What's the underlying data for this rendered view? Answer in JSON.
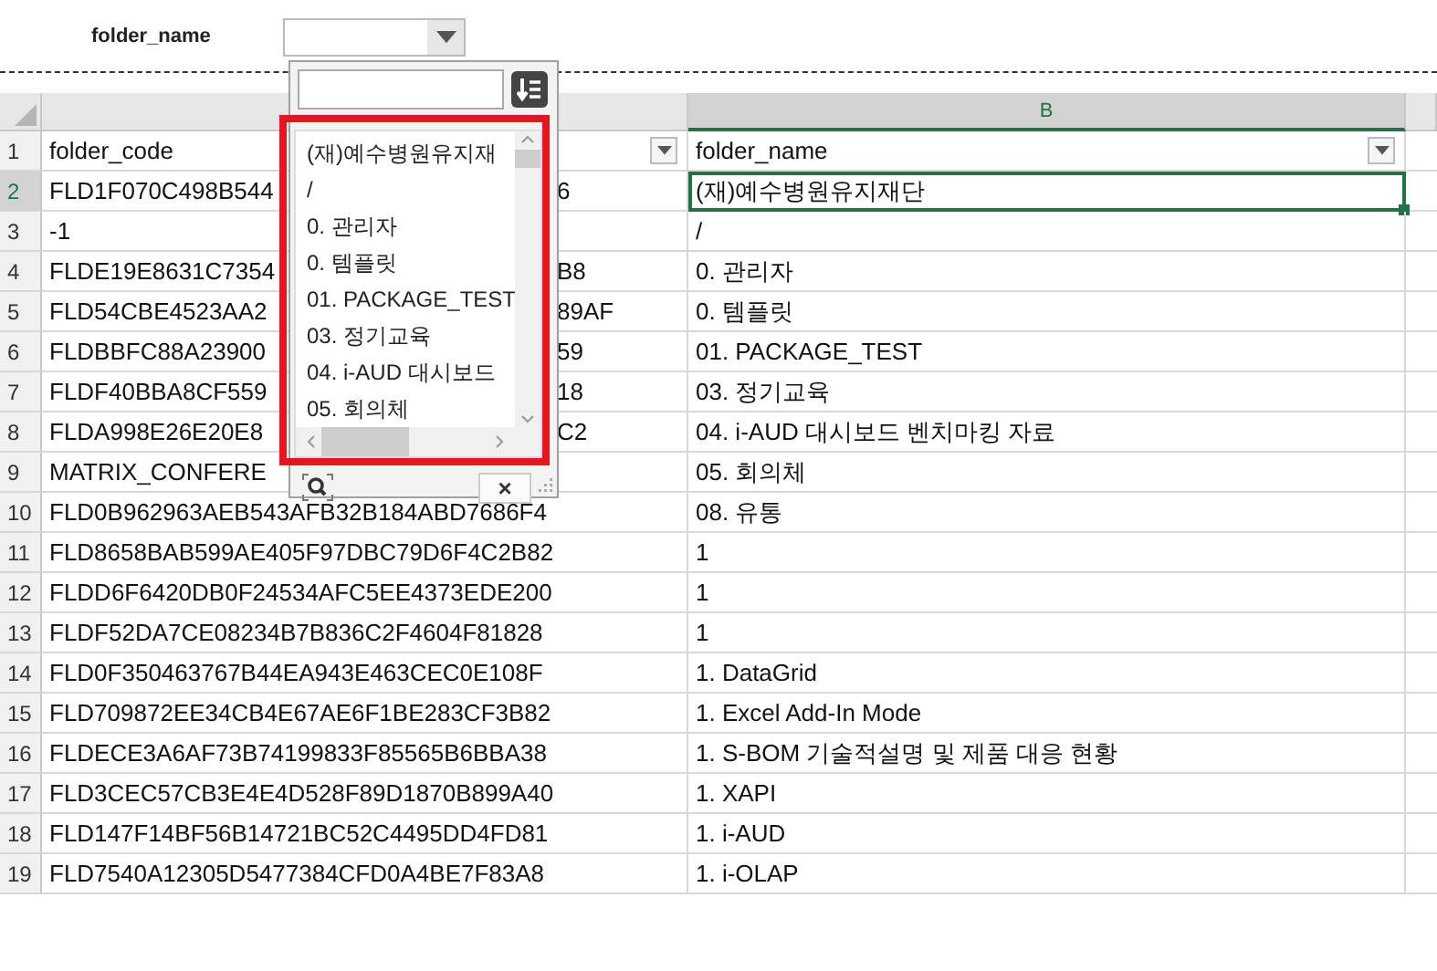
{
  "filter_bar": {
    "label": "folder_name"
  },
  "popup": {
    "items": [
      {
        "text": "(재)예수병원유지재"
      },
      {
        "text": "/"
      },
      {
        "text": "0. 관리자"
      },
      {
        "text": "0. 템플릿"
      },
      {
        "text": "01. PACKAGE_TEST"
      },
      {
        "text": "03. 정기교육"
      },
      {
        "text": "04. i-AUD 대시보드"
      },
      {
        "text": "05. 회의체"
      }
    ],
    "close_label": "×"
  },
  "sheet": {
    "column_headers": [
      {
        "label": "B",
        "selected": true
      }
    ],
    "rows": [
      {
        "number": "1",
        "selected": false,
        "cells": [
          {
            "text": "folder_code",
            "filter": true,
            "selected": false
          },
          {
            "text": "folder_name",
            "filter": true,
            "selected": false
          }
        ]
      },
      {
        "number": "2",
        "selected": true,
        "cells": [
          {
            "text": "FLD1F070C498B544",
            "tail": "6",
            "selected": false
          },
          {
            "text": "(재)예수병원유지재단",
            "selected": true
          }
        ]
      },
      {
        "number": "3",
        "selected": false,
        "cells": [
          {
            "text": "-1",
            "selected": false
          },
          {
            "text": "/",
            "selected": false
          }
        ]
      },
      {
        "number": "4",
        "selected": false,
        "cells": [
          {
            "text": "FLDE19E8631C7354",
            "tail": "B8",
            "selected": false
          },
          {
            "text": "0. 관리자",
            "selected": false
          }
        ]
      },
      {
        "number": "5",
        "selected": false,
        "cells": [
          {
            "text": "FLD54CBE4523AA2",
            "tail": "89AF",
            "selected": false
          },
          {
            "text": "0. 템플릿",
            "selected": false
          }
        ]
      },
      {
        "number": "6",
        "selected": false,
        "cells": [
          {
            "text": "FLDBBFC88A23900",
            "tail": "59",
            "selected": false
          },
          {
            "text": "01. PACKAGE_TEST",
            "selected": false
          }
        ]
      },
      {
        "number": "7",
        "selected": false,
        "cells": [
          {
            "text": "FLDF40BBA8CF559",
            "tail": "18",
            "selected": false
          },
          {
            "text": "03. 정기교육",
            "selected": false
          }
        ]
      },
      {
        "number": "8",
        "selected": false,
        "cells": [
          {
            "text": "FLDA998E26E20E8",
            "tail": "C2",
            "selected": false
          },
          {
            "text": "04. i-AUD 대시보드 벤치마킹 자료",
            "selected": false
          }
        ]
      },
      {
        "number": "9",
        "selected": false,
        "cells": [
          {
            "text": "MATRIX_CONFERE",
            "selected": false
          },
          {
            "text": "05. 회의체",
            "selected": false
          }
        ]
      },
      {
        "number": "10",
        "selected": false,
        "cells": [
          {
            "text": "FLD0B962963AEB543AFB32B184ABD7686F4",
            "selected": false
          },
          {
            "text": "08. 유통",
            "selected": false
          }
        ]
      },
      {
        "number": "11",
        "selected": false,
        "cells": [
          {
            "text": "FLD8658BAB599AE405F97DBC79D6F4C2B82",
            "selected": false
          },
          {
            "text": "1",
            "selected": false
          }
        ]
      },
      {
        "number": "12",
        "selected": false,
        "cells": [
          {
            "text": "FLDD6F6420DB0F24534AFC5EE4373EDE200",
            "selected": false
          },
          {
            "text": "1",
            "selected": false
          }
        ]
      },
      {
        "number": "13",
        "selected": false,
        "cells": [
          {
            "text": "FLDF52DA7CE08234B7B836C2F4604F81828",
            "selected": false
          },
          {
            "text": "1",
            "selected": false
          }
        ]
      },
      {
        "number": "14",
        "selected": false,
        "cells": [
          {
            "text": "FLD0F350463767B44EA943E463CEC0E108F",
            "selected": false
          },
          {
            "text": "1. DataGrid",
            "selected": false
          }
        ]
      },
      {
        "number": "15",
        "selected": false,
        "cells": [
          {
            "text": "FLD709872EE34CB4E67AE6F1BE283CF3B82",
            "selected": false
          },
          {
            "text": "1. Excel Add-In Mode",
            "selected": false
          }
        ]
      },
      {
        "number": "16",
        "selected": false,
        "cells": [
          {
            "text": "FLDECE3A6AF73B74199833F85565B6BBA38",
            "selected": false
          },
          {
            "text": "1. S-BOM 기술적설명 및 제품 대응 현황",
            "selected": false
          }
        ]
      },
      {
        "number": "17",
        "selected": false,
        "cells": [
          {
            "text": "FLD3CEC57CB3E4E4D528F89D1870B899A40",
            "selected": false
          },
          {
            "text": "1. XAPI",
            "selected": false
          }
        ]
      },
      {
        "number": "18",
        "selected": false,
        "cells": [
          {
            "text": "FLD147F14BF56B14721BC52C4495DD4FD81",
            "selected": false
          },
          {
            "text": "1. i-AUD",
            "selected": false
          }
        ]
      },
      {
        "number": "19",
        "selected": false,
        "cells": [
          {
            "text": "FLD7540A12305D5477384CFD0A4BE7F83A8",
            "selected": false
          },
          {
            "text": "1. i-OLAP",
            "selected": false
          }
        ]
      }
    ]
  }
}
